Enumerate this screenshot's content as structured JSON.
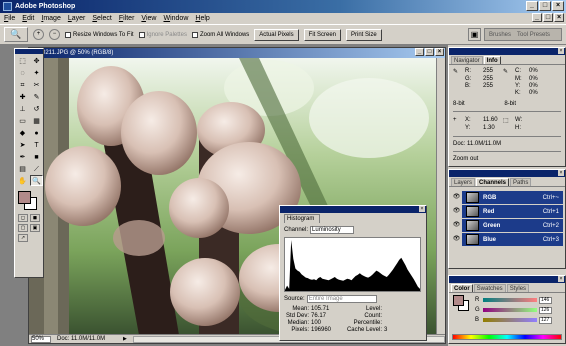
{
  "app": {
    "title": "Adobe Photoshop"
  },
  "menu": [
    "File",
    "Edit",
    "Image",
    "Layer",
    "Select",
    "Filter",
    "View",
    "Window",
    "Help"
  ],
  "options": {
    "resize_windows": "Resize Windows To Fit",
    "ignore_palettes": "Ignore Palettes",
    "zoom_all": "Zoom All Windows",
    "actual_pixels": "Actual Pixels",
    "fit_screen": "Fit Screen",
    "print_size": "Print Size",
    "palette_well_brushes": "Brushes",
    "palette_well_tool_presets": "Tool Presets"
  },
  "document": {
    "title": "...0211.JPG @ 50% (RGB/8)",
    "zoom": "50%",
    "doc_info": "Doc: 11.0M/11.0M"
  },
  "histogram": {
    "tab": "Histogram",
    "channel_label": "Channel:",
    "channel_value": "Luminosity",
    "source_label": "Source:",
    "source_value": "Entire Image",
    "stats": [
      [
        "Mean:",
        "105.71",
        "Level:",
        ""
      ],
      [
        "Std Dev:",
        "76.17",
        "Count:",
        ""
      ],
      [
        "Median:",
        "100",
        "Percentile:",
        ""
      ],
      [
        "Pixels:",
        "196960",
        "Cache Level:",
        "3"
      ]
    ]
  },
  "navigator": {
    "tabs": [
      "Navigator",
      "Info"
    ],
    "rgb_rows": [
      [
        "R:",
        "255"
      ],
      [
        "G:",
        "255"
      ],
      [
        "B:",
        "255"
      ]
    ],
    "cmyk_rows": [
      [
        "C:",
        "0%"
      ],
      [
        "M:",
        "0%"
      ],
      [
        "Y:",
        "0%"
      ],
      [
        "K:",
        "0%"
      ]
    ],
    "bit_left": "8-bit",
    "bit_right": "8-bit",
    "xy": [
      [
        "X:",
        "11.60"
      ],
      [
        "Y:",
        "1.30"
      ]
    ],
    "wh": [
      [
        "W:",
        ""
      ],
      [
        "H:",
        ""
      ]
    ],
    "doc": "Doc: 11.0M/11.0M",
    "hint": "Zoom out"
  },
  "layers": {
    "tabs": [
      "Layers",
      "Channels",
      "Paths"
    ],
    "channels": [
      {
        "name": "RGB",
        "shortcut": "Ctrl+~"
      },
      {
        "name": "Red",
        "shortcut": "Ctrl+1"
      },
      {
        "name": "Green",
        "shortcut": "Ctrl+2"
      },
      {
        "name": "Blue",
        "shortcut": "Ctrl+3"
      }
    ]
  },
  "color": {
    "tabs": [
      "Color",
      "Swatches",
      "Styles"
    ],
    "rows": [
      {
        "label": "R",
        "value": "146"
      },
      {
        "label": "G",
        "value": "126"
      },
      {
        "label": "B",
        "value": "127"
      }
    ]
  },
  "histogram_shape": [
    2,
    10,
    4,
    95,
    60,
    42,
    38,
    36,
    31,
    28,
    25,
    24,
    22,
    21,
    22,
    20,
    24,
    26,
    23,
    22,
    21,
    20,
    22,
    24,
    26,
    23,
    21,
    20,
    19,
    21,
    23,
    22,
    20,
    24,
    28,
    30,
    33,
    30,
    28,
    26,
    25,
    27,
    30,
    34,
    38,
    36,
    33,
    30,
    28,
    26,
    30,
    35,
    40,
    46,
    52,
    58,
    62,
    55,
    48,
    40,
    34,
    28,
    22,
    15,
    8,
    4
  ]
}
